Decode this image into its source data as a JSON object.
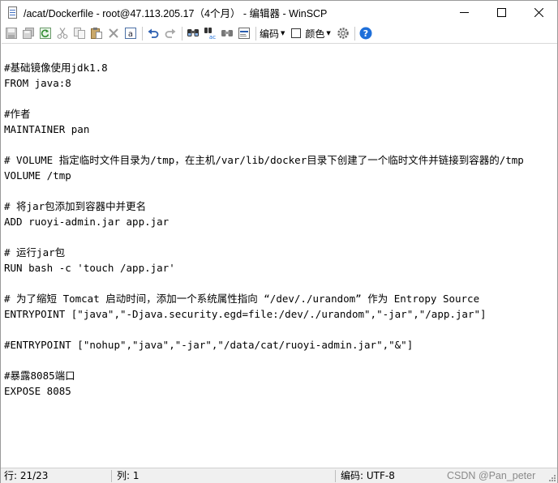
{
  "window": {
    "title": "/acat/Dockerfile - root@47.113.205.17（4个月） - 编辑器 - WinSCP"
  },
  "toolbar": {
    "encoding_label": "编码",
    "color_label": "颜色",
    "icons": [
      "save-icon",
      "save-all-icon",
      "reload-icon",
      "cut-icon",
      "copy-icon",
      "paste-icon",
      "delete-icon",
      "select-all-icon",
      "undo-icon",
      "redo-icon",
      "find-icon",
      "replace-icon",
      "find-next-icon",
      "goto-line-icon",
      "settings-icon",
      "help-icon"
    ]
  },
  "editor": {
    "lines": [
      "",
      "#基础镜像使用jdk1.8",
      "FROM java:8",
      "",
      "#作者",
      "MAINTAINER pan",
      "",
      "# VOLUME 指定临时文件目录为/tmp，在主机/var/lib/docker目录下创建了一个临时文件并链接到容器的/tmp",
      "VOLUME /tmp",
      "",
      "# 将jar包添加到容器中并更名",
      "ADD ruoyi-admin.jar app.jar",
      "",
      "# 运行jar包",
      "RUN bash -c 'touch /app.jar'",
      "",
      "# 为了缩短 Tomcat 启动时间，添加一个系统属性指向 “/dev/./urandom” 作为 Entropy Source",
      "ENTRYPOINT [\"java\",\"-Djava.security.egd=file:/dev/./urandom\",\"-jar\",\"/app.jar\"]",
      "",
      "#ENTRYPOINT [\"nohup\",\"java\",\"-jar\",\"/data/cat/ruoyi-admin.jar\",\"&\"]",
      "",
      "#暴露8085端口",
      "EXPOSE 8085"
    ]
  },
  "status": {
    "line": "行: 21/23",
    "column": "列: 1",
    "encoding": "编码: UTF-8",
    "watermark": "CSDN @Pan_peter"
  },
  "colors": {
    "help_blue": "#1e6fd9",
    "undo_blue": "#2a5db0",
    "status_bg": "#f0f0f0"
  }
}
